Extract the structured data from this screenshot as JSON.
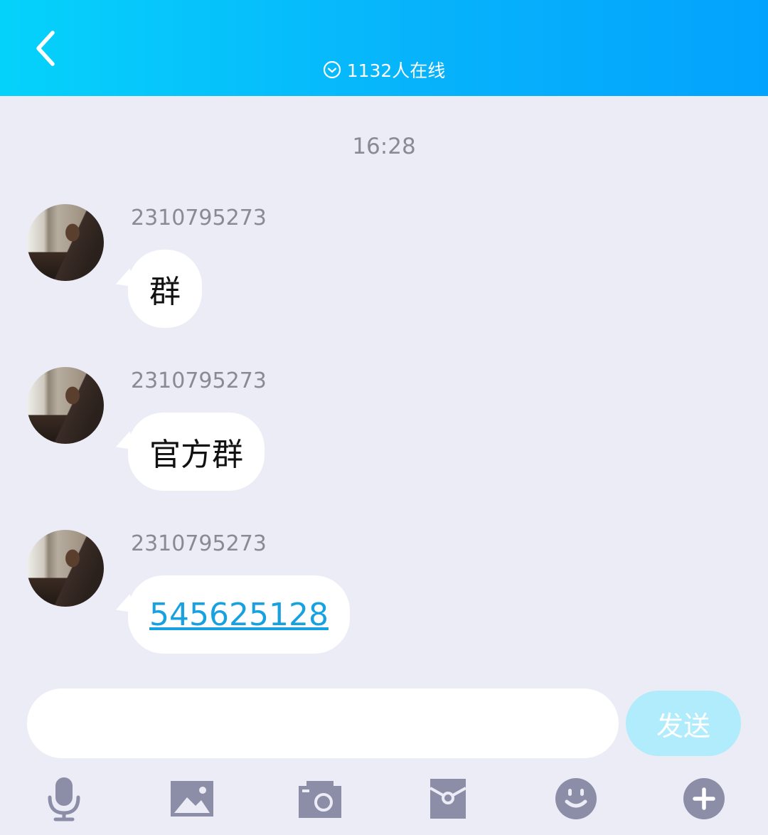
{
  "header": {
    "online_text": "1132人在线",
    "back_icon": "chevron-left-icon",
    "online_icon": "check-circle-icon"
  },
  "chat": {
    "timestamp": "16:28",
    "messages": [
      {
        "sender": "2310795273",
        "text": "群",
        "is_link": false
      },
      {
        "sender": "2310795273",
        "text": "官方群",
        "is_link": false
      },
      {
        "sender": "2310795273",
        "text": "545625128",
        "is_link": true
      }
    ]
  },
  "composer": {
    "input_value": "",
    "placeholder": "",
    "send_label": "发送"
  },
  "toolbar": {
    "icons": [
      "microphone-icon",
      "image-icon",
      "camera-icon",
      "red-packet-icon",
      "emoji-icon",
      "plus-icon"
    ]
  },
  "colors": {
    "header_gradient_start": "#05d2fb",
    "header_gradient_end": "#03a3fd",
    "background": "#ececf6",
    "link": "#17a1e0",
    "send_button": "#b0ecfb",
    "toolbar_icon": "#8c8ea8"
  }
}
